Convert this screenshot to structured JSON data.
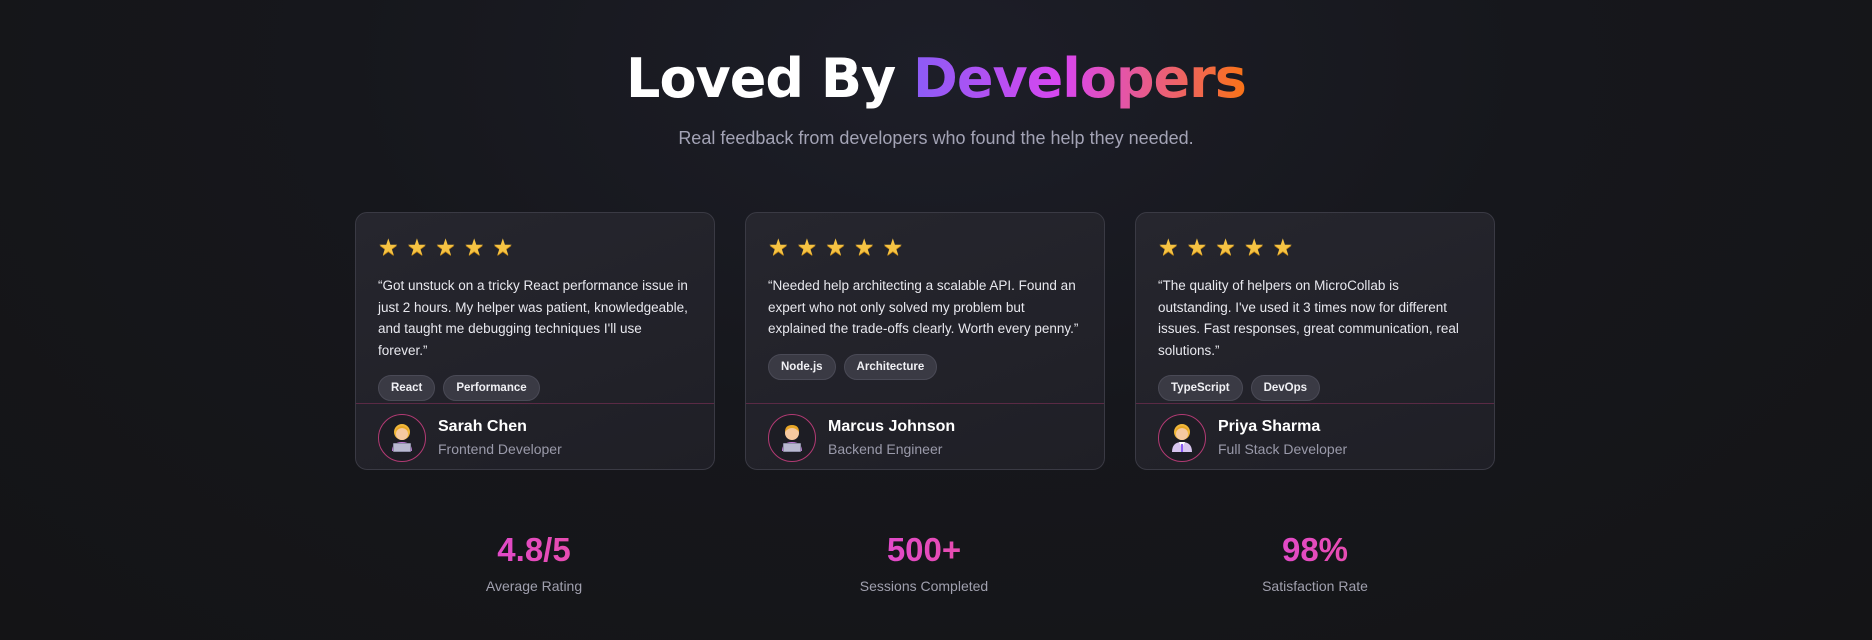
{
  "header": {
    "title_main": "Loved By ",
    "title_accent": "Developers",
    "subtitle": "Real feedback from developers who found the help they needed."
  },
  "testimonials": [
    {
      "rating": 5,
      "quote": "“Got unstuck on a tricky React performance issue in just 2 hours. My helper was patient, knowledgeable, and taught me debugging techniques I'll use forever.”",
      "tags": [
        "React",
        "Performance"
      ],
      "author": "Sarah Chen",
      "role": "Frontend Developer",
      "avatar_icon": "woman-technologist-icon"
    },
    {
      "rating": 5,
      "quote": "“Needed help architecting a scalable API. Found an expert who not only solved my problem but explained the trade-offs clearly. Worth every penny.”",
      "tags": [
        "Node.js",
        "Architecture"
      ],
      "author": "Marcus Johnson",
      "role": "Backend Engineer",
      "avatar_icon": "man-technologist-icon"
    },
    {
      "rating": 5,
      "quote": "“The quality of helpers on MicroCollab is outstanding. I've used it 3 times now for different issues. Fast responses, great communication, real solutions.”",
      "tags": [
        "TypeScript",
        "DevOps"
      ],
      "author": "Priya Sharma",
      "role": "Full Stack Developer",
      "avatar_icon": "woman-office-worker-icon"
    }
  ],
  "stats": [
    {
      "value": "4.8/5",
      "label": "Average Rating"
    },
    {
      "value": "500+",
      "label": "Sessions Completed"
    },
    {
      "value": "98%",
      "label": "Satisfaction Rate"
    }
  ],
  "colors": {
    "background": "#141416",
    "accent_gradient": [
      "#8b5cf6",
      "#d946ef",
      "#f97316"
    ],
    "stat_value": "#e84a9b",
    "star": "#f6c343"
  }
}
